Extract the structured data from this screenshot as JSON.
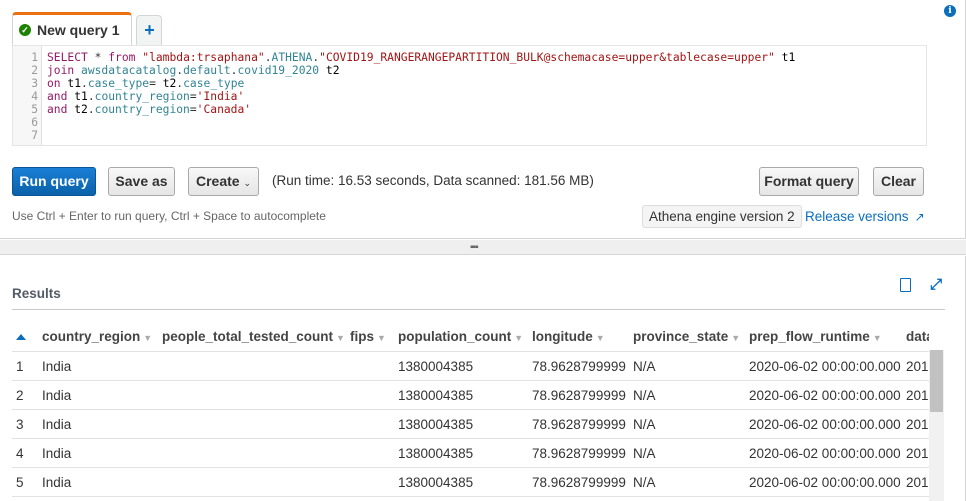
{
  "tabs": [
    {
      "label": "New query 1",
      "status": "success-check-icon",
      "active": true
    }
  ],
  "add_tab_label": "+",
  "editor": {
    "line_numbers": [
      "1",
      "2",
      "3",
      "4",
      "5",
      "6",
      "7"
    ],
    "lines": [
      "SELECT * from \"lambda:trsaphana\".ATHENA.\"COVID19_RANGERANGEPARTITION_BULK@schemacase=upper&tablecase=upper\" t1",
      "join awsdatacatalog.default.covid19_2020 t2",
      "on t1.case_type= t2.case_type",
      "and t1.country_region='India'",
      "and t2.country_region='Canada'",
      "",
      ""
    ]
  },
  "toolbar": {
    "run_query": "Run query",
    "save_as": "Save as",
    "create": "Create",
    "run_stats": "(Run time: 16.53 seconds, Data scanned: 181.56 MB)",
    "format_query": "Format query",
    "clear": "Clear",
    "hint": "Use Ctrl + Enter to run query, Ctrl + Space to autocomplete",
    "engine_badge": "Athena engine version 2",
    "release_link": "Release versions"
  },
  "results": {
    "title": "Results",
    "columns": [
      "country_region",
      "people_total_tested_count",
      "fips",
      "population_count",
      "longitude",
      "province_state",
      "prep_flow_runtime",
      "data_s"
    ],
    "rows": [
      {
        "n": "1",
        "country_region": "India",
        "people_total_tested_count": "",
        "fips": "",
        "population_count": "1380004385",
        "longitude": "78.9628799999",
        "province_state": "N/A",
        "prep_flow_runtime": "2020-06-02 00:00:00.000",
        "data_s": "201"
      },
      {
        "n": "2",
        "country_region": "India",
        "people_total_tested_count": "",
        "fips": "",
        "population_count": "1380004385",
        "longitude": "78.9628799999",
        "province_state": "N/A",
        "prep_flow_runtime": "2020-06-02 00:00:00.000",
        "data_s": "201"
      },
      {
        "n": "3",
        "country_region": "India",
        "people_total_tested_count": "",
        "fips": "",
        "population_count": "1380004385",
        "longitude": "78.9628799999",
        "province_state": "N/A",
        "prep_flow_runtime": "2020-06-02 00:00:00.000",
        "data_s": "201"
      },
      {
        "n": "4",
        "country_region": "India",
        "people_total_tested_count": "",
        "fips": "",
        "population_count": "1380004385",
        "longitude": "78.9628799999",
        "province_state": "N/A",
        "prep_flow_runtime": "2020-06-02 00:00:00.000",
        "data_s": "201"
      },
      {
        "n": "5",
        "country_region": "India",
        "people_total_tested_count": "",
        "fips": "",
        "population_count": "1380004385",
        "longitude": "78.9628799999",
        "province_state": "N/A",
        "prep_flow_runtime": "2020-06-02 00:00:00.000",
        "data_s": "201"
      }
    ]
  },
  "colors": {
    "accent": "#0a6ebd",
    "tab_highlight": "#ec7211",
    "success": "#1d8102"
  }
}
